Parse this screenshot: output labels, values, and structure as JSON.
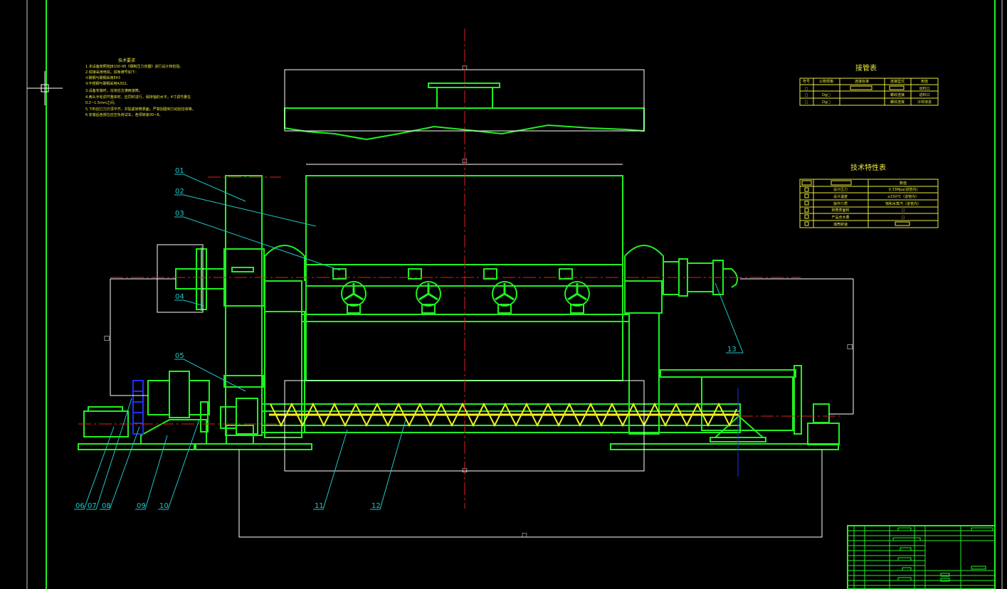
{
  "drawing": {
    "colors": {
      "background": "#000000",
      "outline": "#20f020",
      "leader": "#1ec8c8",
      "centerline": "#e02020",
      "dimension": "#ffffff",
      "table": "#e8e840",
      "spiral": "#f0f020",
      "blue": "#2030f0"
    },
    "tech_req_title": "技术要求",
    "tech_req_lines": [
      "1.本设备按照按JB150-95《钢制压力容器》进行设计和检验。",
      "2.焊接采用电焊，焊条牌号如下：",
      "  ①碳钢与碳钢采用E43",
      "  ②不锈钢与碳钢采用A302。",
      "3.设备安装时，溶液应注满两滚筒。",
      "4.两头手轮调节整体时，应同时进行，保持轴的水平，4寸调节量在",
      "  0.2~1.5mm之间。",
      "5.下料刮刀刀刃须平齐，并贴紧转筒表面，严禁刮碰到刀动刮溶液等。",
      "6.安装后各部位应空负荷试车，各项转速30~8。"
    ],
    "nozzle_table": {
      "title": "接管表",
      "headers": [
        "符号",
        "公称规格",
        "连接标准",
        "连接型式",
        "用途"
      ],
      "rows": [
        [
          "□",
          "",
          "",
          "",
          "出料口"
        ],
        [
          "□",
          "Dg□",
          "",
          "螺纹连接",
          "进料口"
        ],
        [
          "□",
          "Dg□",
          "",
          "螺纹连接",
          "冷却液进"
        ]
      ]
    },
    "tech_table": {
      "title": "技术特性表",
      "headers": [
        "",
        "数值"
      ],
      "rows": [
        [
          "设计压力",
          "0.33Mpa(进管内)"
        ],
        [
          "设计温度",
          "≤150℃（进管内）"
        ],
        [
          "操作介质",
          "饱和水蒸汽（进管内）"
        ],
        [
          "转筒表面积",
          "□"
        ],
        [
          "产品含水量",
          "□"
        ],
        [
          "滚筒转速",
          "□"
        ]
      ]
    },
    "part_labels": [
      "01",
      "02",
      "03",
      "04",
      "05",
      "06",
      "07",
      "08",
      "09",
      "10",
      "11",
      "12",
      "13"
    ],
    "dim_marks": [
      "□",
      "□",
      "□",
      "□",
      "□",
      "□"
    ]
  }
}
